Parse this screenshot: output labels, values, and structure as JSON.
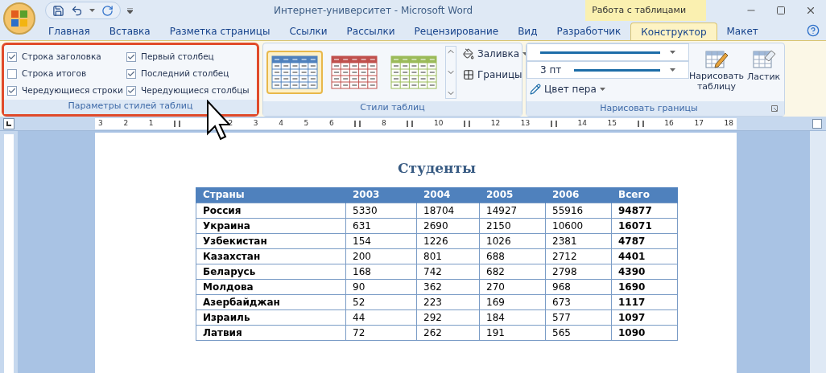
{
  "window": {
    "title": "Интернет-университет - Microsoft Word",
    "context_tab_group": "Работа с таблицами"
  },
  "tabs": [
    {
      "label": "Главная",
      "selected": false
    },
    {
      "label": "Вставка",
      "selected": false
    },
    {
      "label": "Разметка страницы",
      "selected": false
    },
    {
      "label": "Ссылки",
      "selected": false
    },
    {
      "label": "Рассылки",
      "selected": false
    },
    {
      "label": "Рецензирование",
      "selected": false
    },
    {
      "label": "Вид",
      "selected": false
    },
    {
      "label": "Разработчик",
      "selected": false
    },
    {
      "label": "Конструктор",
      "selected": true
    },
    {
      "label": "Макет",
      "selected": false
    }
  ],
  "style_options": {
    "label": "Параметры стилей таблиц",
    "checkboxes": [
      {
        "label": "Строка заголовка",
        "checked": true
      },
      {
        "label": "Строка итогов",
        "checked": false
      },
      {
        "label": "Чередующиеся строки",
        "checked": true
      },
      {
        "label": "Первый столбец",
        "checked": true
      },
      {
        "label": "Последний столбец",
        "checked": true
      },
      {
        "label": "Чередующиеся столбцы",
        "checked": true
      }
    ]
  },
  "table_styles": {
    "label": "Стили таблиц",
    "styles": [
      {
        "color": "#4f81bd",
        "selected": true
      },
      {
        "color": "#c0504d",
        "selected": false
      },
      {
        "color": "#9bbb59",
        "selected": false
      }
    ],
    "shading": "Заливка",
    "borders": "Границы"
  },
  "draw_borders": {
    "label": "Нарисовать границы",
    "weight": "3 пт",
    "pen_color": "Цвет пера",
    "draw_table": "Нарисовать таблицу",
    "eraser": "Ластик"
  },
  "ruler": [
    {
      "kind": "number",
      "text": "3"
    },
    {
      "kind": "number",
      "text": "2"
    },
    {
      "kind": "number",
      "text": "1"
    },
    {
      "kind": "grid"
    },
    {
      "kind": "blank"
    },
    {
      "kind": "number",
      "text": "2"
    },
    {
      "kind": "number",
      "text": "3"
    },
    {
      "kind": "number",
      "text": "4"
    },
    {
      "kind": "number",
      "text": "5"
    },
    {
      "kind": "number",
      "text": "6"
    },
    {
      "kind": "grid"
    },
    {
      "kind": "number",
      "text": "8"
    },
    {
      "kind": "grid"
    },
    {
      "kind": "number",
      "text": "10"
    },
    {
      "kind": "grid"
    },
    {
      "kind": "number",
      "text": "12"
    },
    {
      "kind": "number",
      "text": "13"
    },
    {
      "kind": "grid"
    },
    {
      "kind": "number",
      "text": "14"
    },
    {
      "kind": "number",
      "text": "15"
    },
    {
      "kind": "grid"
    },
    {
      "kind": "number",
      "text": "16"
    },
    {
      "kind": "number",
      "text": "17"
    },
    {
      "kind": "number",
      "text": "18"
    }
  ],
  "document": {
    "heading": "Студенты",
    "table": {
      "columns": [
        "Страны",
        "2003",
        "2004",
        "2005",
        "2006",
        "Всего"
      ],
      "rows": [
        [
          "Россия",
          "5330",
          "18704",
          "14927",
          "55916",
          "94877"
        ],
        [
          "Украина",
          "631",
          "2690",
          "2150",
          "10600",
          "16071"
        ],
        [
          "Узбекистан",
          "154",
          "1226",
          "1026",
          "2381",
          "4787"
        ],
        [
          "Казахстан",
          "200",
          "801",
          "688",
          "2712",
          "4401"
        ],
        [
          "Беларусь",
          "168",
          "742",
          "682",
          "2798",
          "4390"
        ],
        [
          "Молдова",
          "90",
          "362",
          "270",
          "968",
          "1690"
        ],
        [
          "Азербайджан",
          "52",
          "223",
          "169",
          "673",
          "1117"
        ],
        [
          "Израиль",
          "44",
          "292",
          "184",
          "577",
          "1097"
        ],
        [
          "Латвия",
          "72",
          "262",
          "191",
          "565",
          "1090"
        ]
      ]
    }
  }
}
